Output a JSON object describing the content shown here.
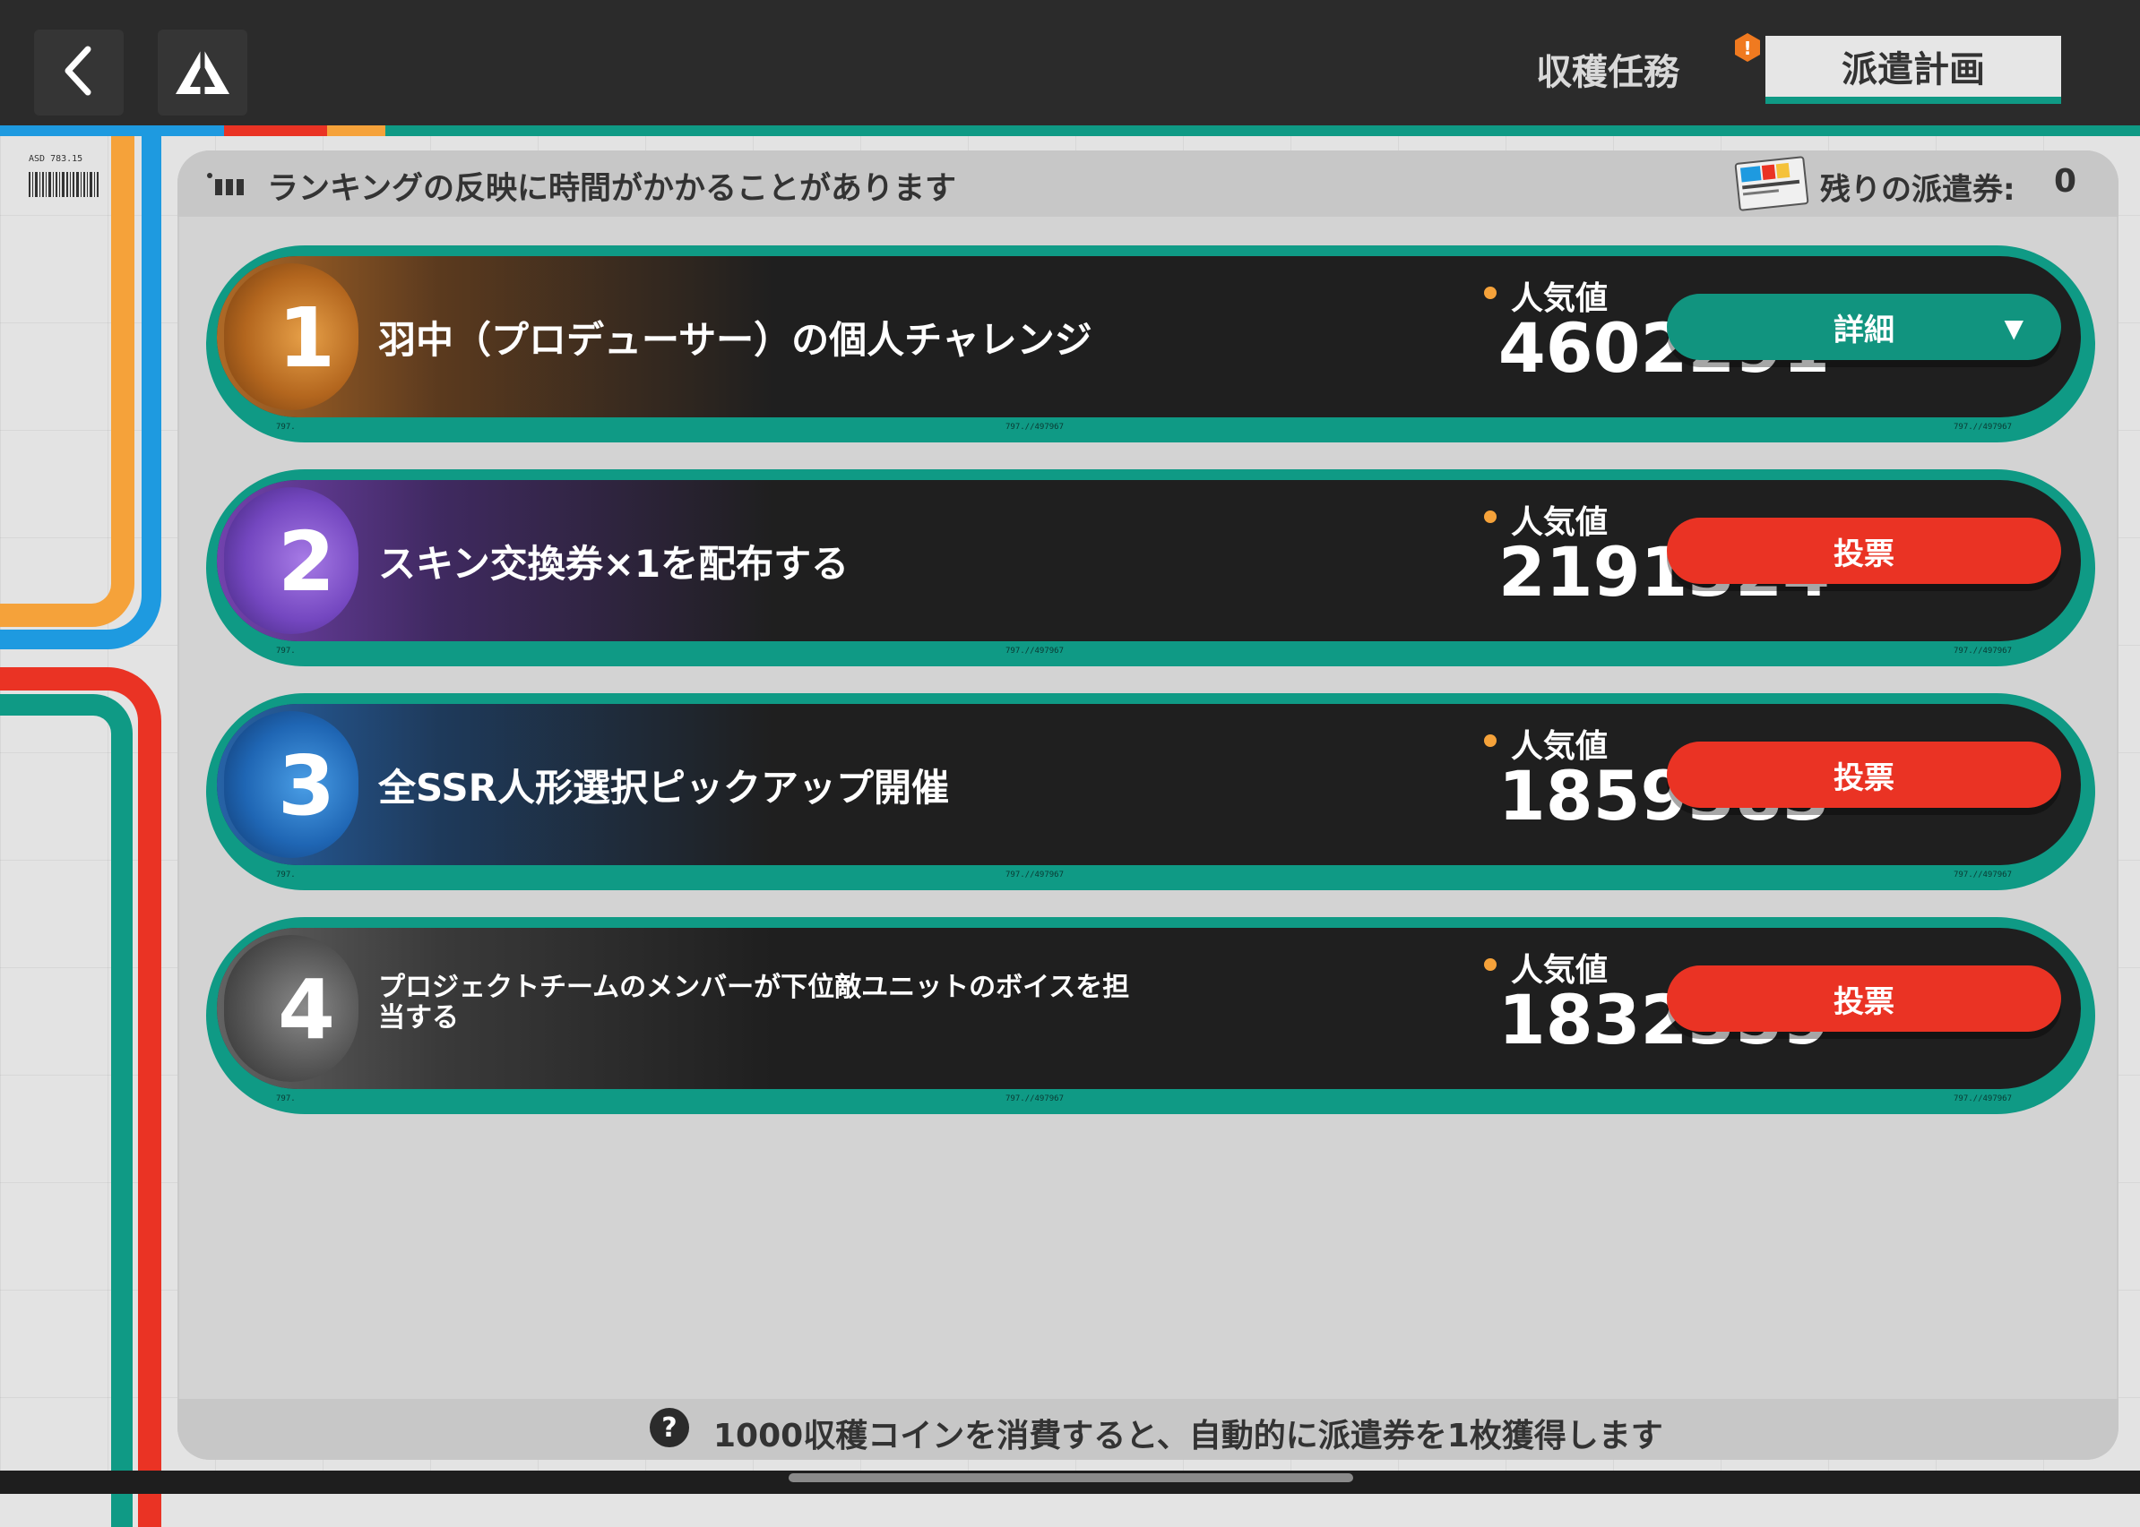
{
  "header": {
    "tabs": [
      {
        "label": "収穫任務",
        "active": false,
        "alert": false
      },
      {
        "label": "派遣計画",
        "active": true,
        "alert": true
      }
    ]
  },
  "notice": "ランキングの反映に時間がかかることがあります",
  "tickets": {
    "label": "残りの派遣券:",
    "count": "0"
  },
  "rankings": [
    {
      "rank": "1",
      "title": "羽中（プロデューサー）の個人チャレンジ",
      "pop_label": "人気値",
      "pop_value": "4602291",
      "button": "詳細",
      "button_type": "teal"
    },
    {
      "rank": "2",
      "title": "スキン交換券×1を配布する",
      "pop_label": "人気値",
      "pop_value": "2191324",
      "button": "投票",
      "button_type": "red"
    },
    {
      "rank": "3",
      "title": "全SSR人形選択ピックアップ開催",
      "pop_label": "人気値",
      "pop_value": "1859383",
      "button": "投票",
      "button_type": "red"
    },
    {
      "rank": "4",
      "title": "プロジェクトチームのメンバーが下位敵ユニットのボイスを担当する",
      "pop_label": "人気値",
      "pop_value": "1832359",
      "button": "投票",
      "button_type": "red"
    }
  ],
  "footer": {
    "text": "1000収穫コインを消費すると、自動的に派遣券を1枚獲得します"
  },
  "icons": {
    "back": "chevron-left-icon",
    "logo": "triangle-logo-icon",
    "help": "question-icon",
    "ticket": "ticket-icon",
    "alert": "alert-icon"
  },
  "colors": {
    "teal": "#0f9a85",
    "red": "#ea3324",
    "orange": "#f5a23a",
    "blue": "#1e9ae0",
    "dark": "#1f1f1f"
  }
}
